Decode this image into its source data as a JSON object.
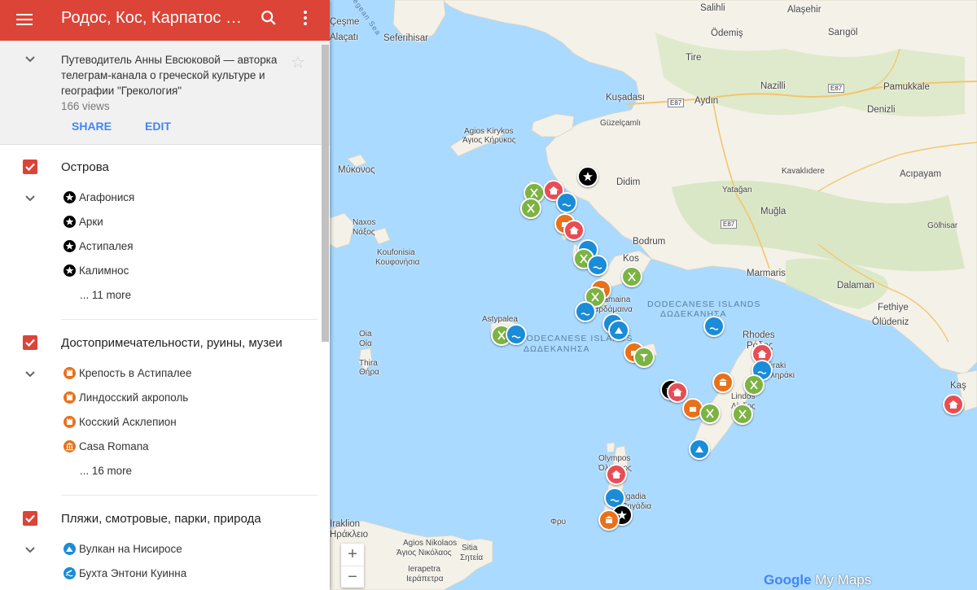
{
  "header": {
    "title": "Родос, Кос, Карпатос и д..."
  },
  "info": {
    "description": "Путеводитель Анны Евсюковой — авторка телеграм-канала о греческой культуре и географии \"Грекология\"",
    "views": "166 views",
    "share_label": "SHARE",
    "edit_label": "EDIT"
  },
  "layers": [
    {
      "title": "Острова",
      "items": [
        "Агафонися",
        "Арки",
        "Астипалея",
        "Калимнос"
      ],
      "more": "... 11 more"
    },
    {
      "title": "Достопримечательности, руины, музеи",
      "items": [
        "Крепость в Астипалее",
        "Линдосский акрополь",
        "Косский Асклепион",
        "Casa Romana"
      ],
      "more": "... 16 more"
    },
    {
      "title": "Пляжи, смотровые, парки, природа",
      "items": [
        "Вулкан на Нисиросе",
        "Бухта Энтони Куинна"
      ]
    }
  ],
  "map": {
    "places": [
      "Alaşehir",
      "Salihli",
      "Çeşme",
      "Seferihisar",
      "Alaçatı",
      "Ödemiş",
      "Sarıgöl",
      "Tire",
      "Kuşadası",
      "Nazilli",
      "Pamukkale",
      "Aydın",
      "Denizli",
      "Güzelçamlı",
      "Agios Kirykos",
      "Άγιος Κήρυκος",
      "Μύκονος",
      "Didim",
      "Yatağan",
      "Kavaklıdere",
      "Acıpayam",
      "Muğla",
      "Naxos",
      "Νάξος",
      "Bodrum",
      "Gölhisar",
      "Koufonisia",
      "Κουφονήσια",
      "Kos",
      "Marmaris",
      "Dalaman",
      "Fethiye",
      "Kalamaina",
      "Καρδάμαινα",
      "Oia",
      "Οία",
      "Astypalea",
      "Rhodes",
      "Ρόδος",
      "Faliraki",
      "Φαληράκι",
      "Lindos",
      "Λίνδος",
      "Ölüdeniz",
      "Kaş",
      "Olympos",
      "Όλυμπος",
      "Pigadia",
      "Πηγάδια",
      "Φρυ",
      "Iraklion",
      "Ηράκλειο",
      "Agios Nikolaos",
      "Άγιος Νικόλαος",
      "Σητεία",
      "Sitia",
      "Ierapetra",
      "Ιεράπετρα",
      "Thira",
      "Θήρα"
    ],
    "water": [
      "Aegean Sea",
      "DODECANESE ISLANDS",
      "ΔΩΔΕΚΑΝΗΣΑ",
      "DODECANESE ISLANDS",
      "ΔΩΔΕΚΑΝΗΣΑ"
    ],
    "roads": [
      "E87",
      "E87",
      "E87"
    ],
    "zoom_in": "+",
    "zoom_out": "−",
    "logo": "Google",
    "logo_suffix": "My Maps"
  },
  "colors": {
    "accent": "#db4437",
    "link": "#4285f4",
    "island": "#000000",
    "sight": "#e8711a",
    "beach": "#1a8cd8",
    "food": "#7cb342",
    "hotel": "#e84d55"
  }
}
